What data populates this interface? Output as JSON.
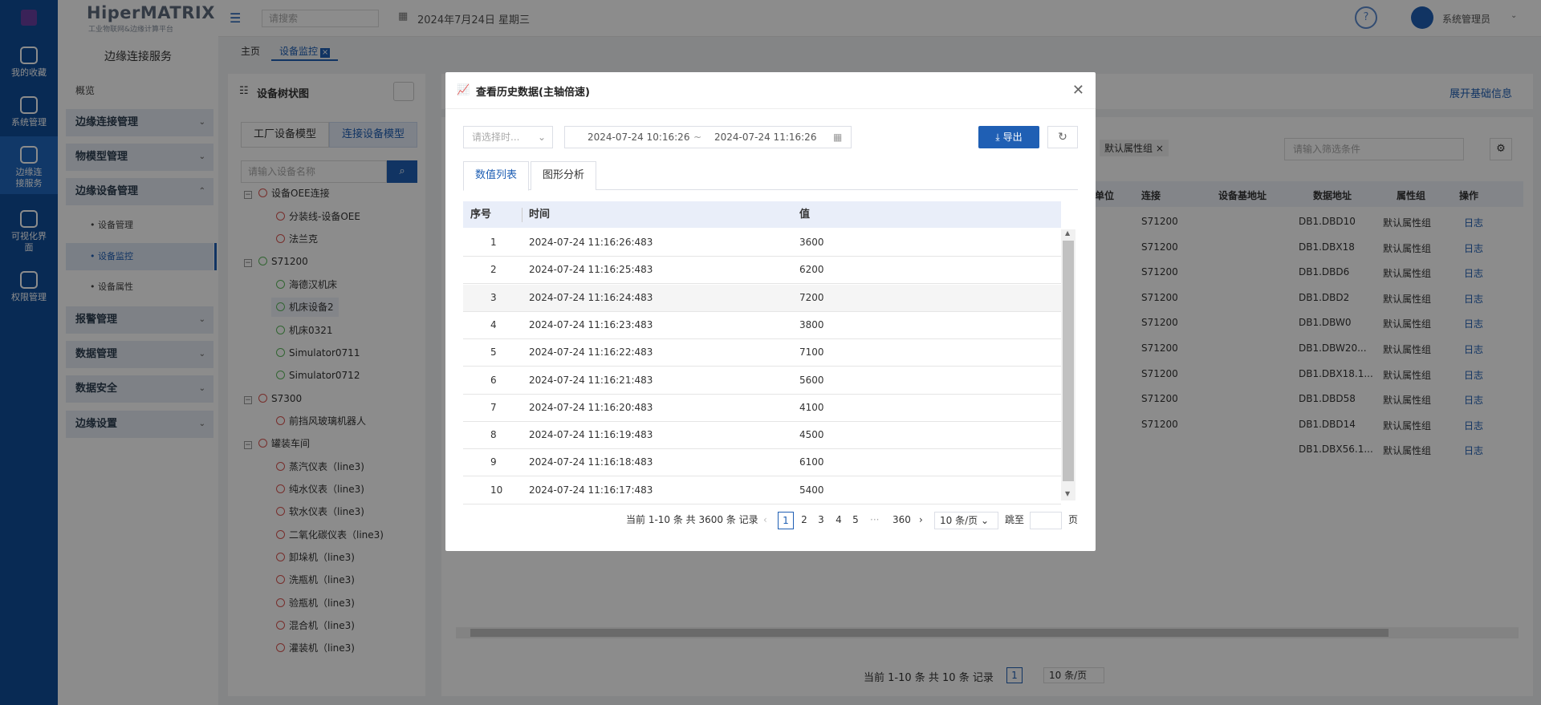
{
  "rail": {
    "items": [
      "我的收藏",
      "系统管理",
      "边缘连接服务",
      "可视化界面",
      "权限管理"
    ]
  },
  "brand": {
    "title": "HiperMATRIX",
    "subtitle": "工业物联网&边缘计算平台"
  },
  "topbar": {
    "search_placeholder": "请搜索",
    "date": "2024年7月24日 星期三",
    "user": "系统管理员"
  },
  "sidebar": {
    "title": "边缘连接服务",
    "overview": "概览",
    "groups": [
      "边缘连接管理",
      "物模型管理",
      "边缘设备管理",
      "报警管理",
      "数据管理",
      "数据安全",
      "边缘设置"
    ],
    "sub_items": [
      "设备管理",
      "设备监控",
      "设备属性"
    ]
  },
  "tabs": {
    "home": "主页",
    "current": "设备监控"
  },
  "tree": {
    "title": "设备树状图",
    "tab_factory": "工厂设备模型",
    "tab_connect": "连接设备模型",
    "search_placeholder": "请输入设备名称",
    "nodes": [
      "设备OEE连接",
      "分装线-设备OEE",
      "法兰克",
      "S71200",
      "海德汉机床",
      "机床设备2",
      "机床0321",
      "Simulator0711",
      "Simulator0712",
      "S7300",
      "前挡风玻璃机器人",
      "罐装车间",
      "蒸汽仪表（line3)",
      "纯水仪表（line3)",
      "软水仪表（line3)",
      "二氧化碳仪表（line3)",
      "卸垛机（line3)",
      "洗瓶机（line3)",
      "验瓶机（line3)",
      "混合机（line3)",
      "灌装机（line3)"
    ]
  },
  "right": {
    "expand": "展开基础信息",
    "tag": "默认属性组",
    "filter_placeholder": "请输入筛选条件",
    "headers": [
      "单位",
      "连接",
      "设备基地址",
      "数据地址",
      "属性组",
      "操作"
    ],
    "rows": [
      {
        "conn": "S71200",
        "addr": "DB1.DBD10",
        "group": "默认属性组",
        "op": "日志"
      },
      {
        "conn": "S71200",
        "addr": "DB1.DBX18",
        "group": "默认属性组",
        "op": "日志"
      },
      {
        "conn": "S71200",
        "addr": "DB1.DBD6",
        "group": "默认属性组",
        "op": "日志"
      },
      {
        "conn": "S71200",
        "addr": "DB1.DBD2",
        "group": "默认属性组",
        "op": "日志"
      },
      {
        "conn": "S71200",
        "addr": "DB1.DBW0",
        "group": "默认属性组",
        "op": "日志"
      },
      {
        "conn": "S71200",
        "addr": "DB1.DBW20...",
        "group": "默认属性组",
        "op": "日志"
      },
      {
        "conn": "S71200",
        "addr": "DB1.DBX18.1...",
        "group": "默认属性组",
        "op": "日志"
      },
      {
        "conn": "S71200",
        "addr": "DB1.DBD58",
        "group": "默认属性组",
        "op": "日志"
      },
      {
        "conn": "S71200",
        "addr": "DB1.DBD14",
        "group": "默认属性组",
        "op": "日志"
      },
      {
        "conn": "",
        "addr": "DB1.DBX56.1...",
        "group": "默认属性组",
        "op": "日志"
      }
    ],
    "pager_text": "当前 1-10 条 共 10 条 记录",
    "page": "1",
    "page_size": "10 条/页"
  },
  "modal": {
    "title": "查看历史数据(主轴倍速)",
    "time_placeholder": "请选择时...",
    "start": "2024-07-24 10:16:26",
    "sep": "~",
    "end": "2024-07-24 11:16:26",
    "export": "导出",
    "tab_values": "数值列表",
    "tab_chart": "图形分析",
    "col_index": "序号",
    "col_time": "时间",
    "col_value": "值",
    "rows": [
      {
        "i": "1",
        "t": "2024-07-24 11:16:26:483",
        "v": "3600"
      },
      {
        "i": "2",
        "t": "2024-07-24 11:16:25:483",
        "v": "6200"
      },
      {
        "i": "3",
        "t": "2024-07-24 11:16:24:483",
        "v": "7200"
      },
      {
        "i": "4",
        "t": "2024-07-24 11:16:23:483",
        "v": "3800"
      },
      {
        "i": "5",
        "t": "2024-07-24 11:16:22:483",
        "v": "7100"
      },
      {
        "i": "6",
        "t": "2024-07-24 11:16:21:483",
        "v": "5600"
      },
      {
        "i": "7",
        "t": "2024-07-24 11:16:20:483",
        "v": "4100"
      },
      {
        "i": "8",
        "t": "2024-07-24 11:16:19:483",
        "v": "4500"
      },
      {
        "i": "9",
        "t": "2024-07-24 11:16:18:483",
        "v": "6100"
      },
      {
        "i": "10",
        "t": "2024-07-24 11:16:17:483",
        "v": "5400"
      }
    ],
    "pager": {
      "summary": "当前 1-10 条 共 3600 条 记录",
      "pages": [
        "1",
        "2",
        "3",
        "4",
        "5"
      ],
      "ellipsis": "···",
      "last": "360",
      "size": "10 条/页",
      "jump": "跳至",
      "unit": "页"
    }
  }
}
